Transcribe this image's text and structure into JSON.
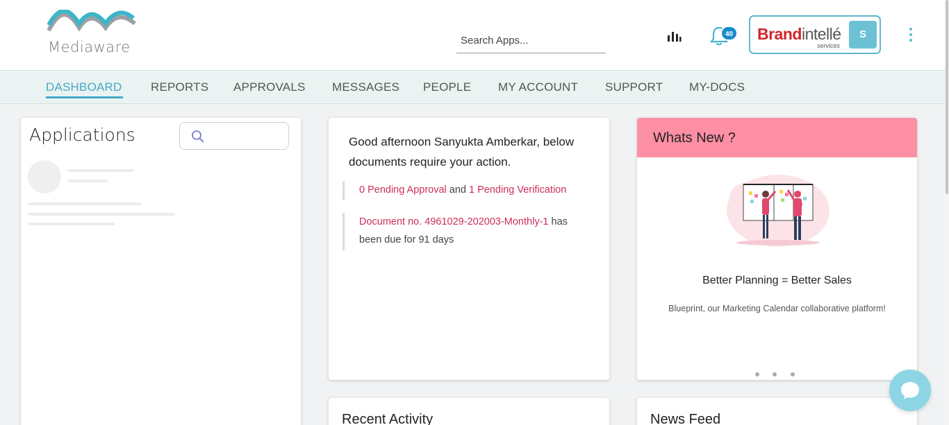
{
  "header": {
    "logo_text": "Mediaware",
    "search_placeholder": "Search Apps...",
    "notification_count": "40",
    "brand": {
      "part1": "Brand",
      "part2": "intellé",
      "sub": "services"
    },
    "avatar_initial": "S"
  },
  "nav": {
    "items": [
      {
        "label": "DASHBOARD"
      },
      {
        "label": "REPORTS"
      },
      {
        "label": "APPROVALS"
      },
      {
        "label": "MESSAGES"
      },
      {
        "label": "PEOPLE"
      },
      {
        "label": "MY ACCOUNT"
      },
      {
        "label": "SUPPORT"
      },
      {
        "label": "MY-DOCS"
      }
    ]
  },
  "applications": {
    "title": "Applications"
  },
  "actions": {
    "greeting": "Good afternoon Sanyukta Amberkar, below documents require your action.",
    "pending_approval": "0 Pending Approval",
    "and": "and",
    "pending_verification": "1 Pending Verification",
    "document_link": "Document no. 4961029-202003-Monthly-1",
    "document_suffix": "has been due for 91 days"
  },
  "whats_new": {
    "title": "Whats New ?",
    "slide_title": "Better Planning = Better Sales",
    "slide_desc": "Blueprint, our Marketing Calendar collaborative platform!"
  },
  "recent_activity": {
    "title": "Recent Activity"
  },
  "news_feed": {
    "title": "News Feed"
  },
  "colors": {
    "accent": "#45a8c9",
    "whats_new_header": "#fd8fa5",
    "link_red": "#cc2e5a",
    "badge_blue": "#1a8cc7"
  }
}
